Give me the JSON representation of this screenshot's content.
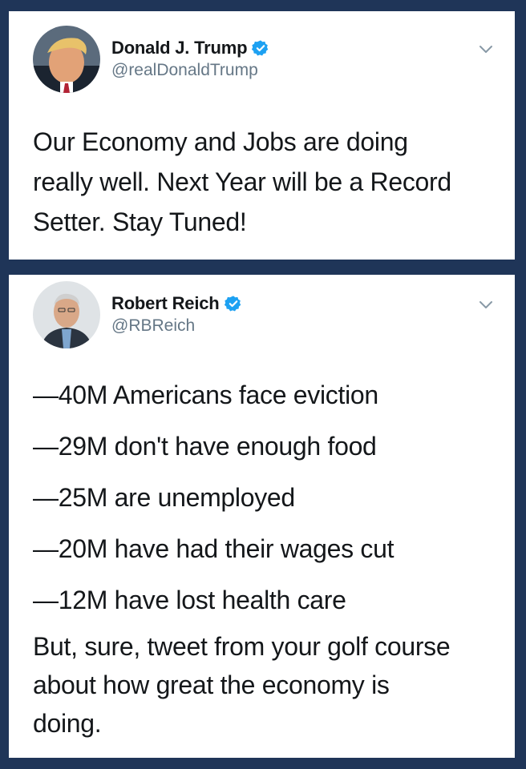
{
  "tweets": [
    {
      "display_name": "Donald J. Trump",
      "handle": "@realDonaldTrump",
      "verified": true,
      "text_lines": [
        "Our Economy and Jobs are doing",
        "really well. Next Year will be a Record",
        "Setter. Stay Tuned!"
      ]
    },
    {
      "display_name": "Robert Reich",
      "handle": "@RBReich",
      "verified": true,
      "stat_lines": [
        "—40M Americans face eviction",
        "—29M don't have enough food",
        "—25M are unemployed",
        "—20M have had their wages cut",
        "—12M have lost health care"
      ],
      "closing_lines": [
        "But, sure, tweet from your golf course",
        "about how great the economy is",
        "doing."
      ]
    }
  ],
  "colors": {
    "background": "#1f3558",
    "card": "#ffffff",
    "verified": "#1da1f2",
    "handle": "#657786",
    "text": "#14171a"
  },
  "icons": {
    "verified": "verified-badge-icon",
    "menu": "chevron-down-icon",
    "avatar_1": "avatar",
    "avatar_2": "avatar"
  }
}
